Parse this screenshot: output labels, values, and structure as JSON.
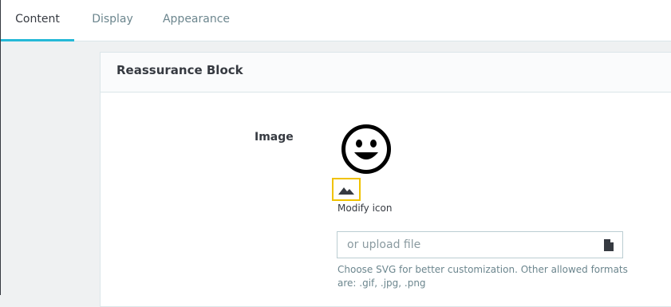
{
  "tabs": [
    {
      "label": "Content"
    },
    {
      "label": "Display"
    },
    {
      "label": "Appearance"
    }
  ],
  "panel": {
    "title": "Reassurance Block"
  },
  "form": {
    "image_label": "Image",
    "modify_icon_label": "Modify icon",
    "upload_placeholder": "or upload file",
    "help_text": "Choose SVG for better customization. Other allowed formats are: .gif, .jpg, .png"
  },
  "icons": {
    "preview": "smiley-face-icon",
    "modify": "mountain-icon",
    "upload": "file-icon"
  },
  "colors": {
    "active_tab_accent": "#25b9d7",
    "icon_button_border": "#f0c200"
  }
}
